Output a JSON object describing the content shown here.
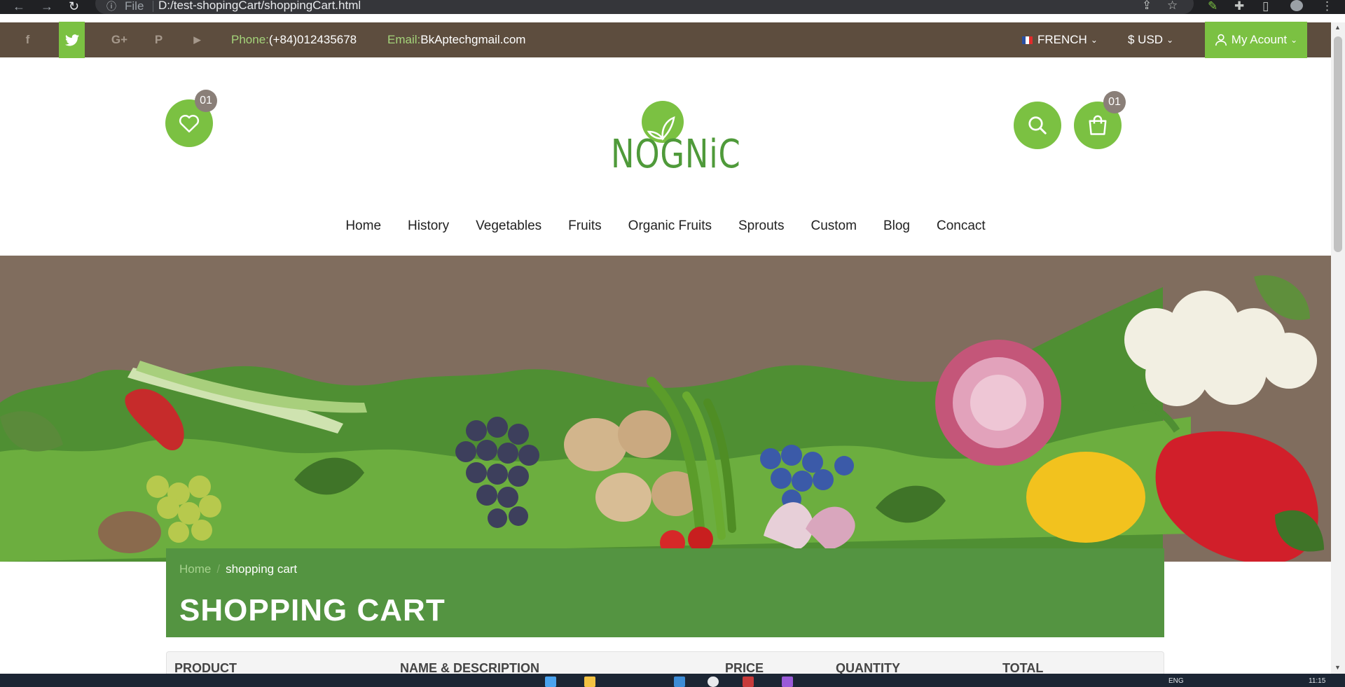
{
  "browser": {
    "address_label": "File",
    "url": "D:/test-shopingCart/shoppingCart.html",
    "icons": [
      "back-arrow-icon",
      "forward-arrow-icon",
      "reload-icon",
      "info-icon",
      "share-icon",
      "star-icon",
      "pen-icon",
      "puzzle-icon",
      "sidebar-icon",
      "profile-icon",
      "menu-dots-icon"
    ]
  },
  "topbar": {
    "social": [
      "facebook-icon",
      "twitter-icon",
      "google-plus-icon",
      "pinterest-icon",
      "youtube-icon"
    ],
    "social_glyphs": [
      "f",
      "t",
      "G+",
      "P",
      "▶"
    ],
    "phone_label": "Phone:",
    "phone": "(+84)012435678",
    "email_label": "Email:",
    "email": "BkAptechgmail.com",
    "language": "FRENCH",
    "currency": "$ USD",
    "account": "My Acount",
    "accent_color": "#7bc142",
    "bar_color": "#5d4d3e"
  },
  "header": {
    "wishlist_count": "01",
    "cart_count": "01",
    "logo_text": "NOGNiC"
  },
  "menu": [
    "Home",
    "History",
    "Vegetables",
    "Fruits",
    "Organic Fruits",
    "Sprouts",
    "Custom",
    "Blog",
    "Concact"
  ],
  "breadcrumb": {
    "home": "Home",
    "separator": "/",
    "current": "shopping cart"
  },
  "cart": {
    "title": "SHOPPING CART",
    "columns": [
      "PRODUCT",
      "NAME & DESCRIPTION",
      "PRICE",
      "QUANTITY",
      "TOTAL"
    ],
    "header_color": "#549441"
  },
  "taskbar": {
    "language": "ENG",
    "time": "11:15"
  }
}
